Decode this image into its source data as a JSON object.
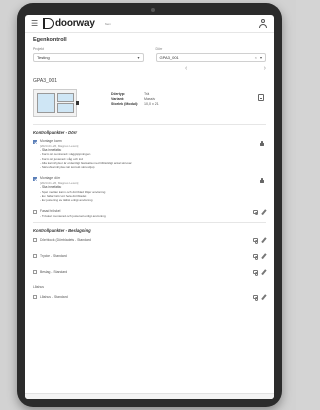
{
  "app": {
    "logo_text": "doorway",
    "topbar_sub": "Nem",
    "page_title": "Egenkontroll"
  },
  "fields": {
    "project_label": "Projekt",
    "project_value": "Testing",
    "door_label": "Dörr",
    "door_value": "GPA3_001",
    "prev_glyph": "‹",
    "next_glyph": "›"
  },
  "door": {
    "id": "GPA3_001",
    "specs": [
      {
        "key": "Dörrtyp:",
        "value": "Trä"
      },
      {
        "key": "Variant:",
        "value": "Massiv"
      },
      {
        "key": "Storlek (Modul):",
        "value": "10,0 x 21"
      }
    ]
  },
  "sections": {
    "door_title": "Kontrollpunkter - Dörr",
    "hardware_title": "Kontrollpunkter - Beslagning"
  },
  "door_items": [
    {
      "title": "Montage karm",
      "meta": "[2023-01-26, Magnus Lexén]",
      "sub": "- Ska innefatta:",
      "bullets": [
        "- Karm är centrerad i väggöppningen",
        "- Karm är justerad i våg och lod",
        "- Alla karmhylsor är ordentligt fastsatta med tillräckligt antal skruvar",
        "- Skruv/karmhylsa när korrekt skruvdjup"
      ]
    },
    {
      "title": "Montage dörr",
      "meta": "[2023-01-26, Magnus Lexén]",
      "sub": "- Ska innefatta:",
      "bullets": [
        "- Spel mellan karm och dörrblad följer anvisning",
        "- Ev. fallar lätt runt hela dörrbladet",
        "- Ev justering av tätlist enligt anvisning"
      ]
    },
    {
      "title": "Fasad tröskel",
      "meta": "",
      "sub": "",
      "bullets": [
        "- Tröskel monterad och justerad enligt anvisning"
      ]
    }
  ],
  "hardware_items": [
    {
      "title": "Dörrblock (Dörrbladets - Standard"
    },
    {
      "title": "Trycke - Standard"
    },
    {
      "title": "Beslag - Standard"
    },
    {
      "title": "Låshus"
    },
    {
      "title": "Låshus - Standard"
    }
  ],
  "colors": {
    "accent": "#5b7fb8",
    "check_active": "#5b7fb8"
  },
  "icons": {
    "menu": "hamburger-icon",
    "user": "user-icon",
    "document": "document-icon",
    "lock": "lock-icon",
    "camera": "camera-icon",
    "edit": "pencil-icon"
  }
}
